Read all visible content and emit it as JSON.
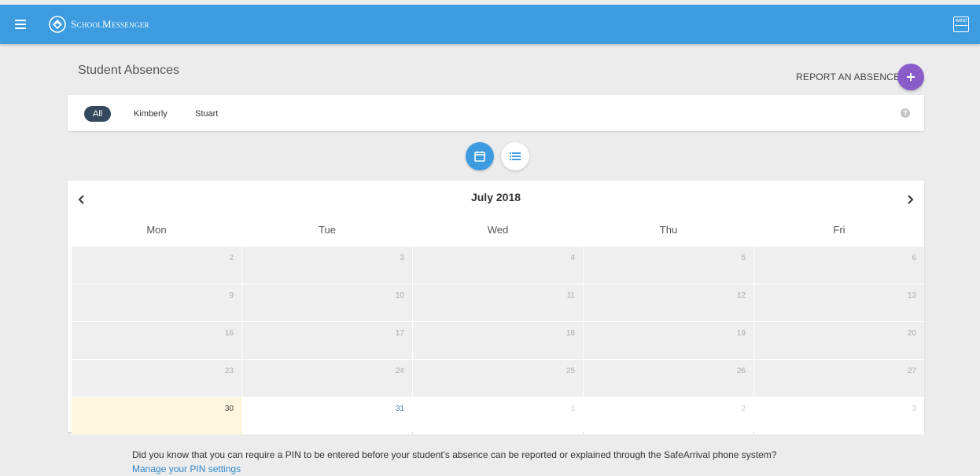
{
  "app": {
    "brand": "SchoolMessenger",
    "user_badge": "west"
  },
  "page": {
    "title": "Student Absences",
    "report_label": "REPORT AN ABSENCE"
  },
  "filters": {
    "chips": [
      "All",
      "Kimberly",
      "Stuart"
    ],
    "active": "All"
  },
  "calendar": {
    "month_label": "July 2018",
    "weekdays": [
      "Mon",
      "Tue",
      "Wed",
      "Thu",
      "Fri"
    ],
    "weeks": [
      [
        "2",
        "3",
        "4",
        "5",
        "6"
      ],
      [
        "9",
        "10",
        "11",
        "12",
        "13"
      ],
      [
        "16",
        "17",
        "18",
        "19",
        "20"
      ],
      [
        "23",
        "24",
        "25",
        "26",
        "27"
      ],
      [
        "30",
        "31",
        "1",
        "2",
        "3"
      ]
    ],
    "today": "30"
  },
  "footer": {
    "pin_notice": "Did you know that you can require a PIN to be entered before your student's absence can be reported or explained through the SafeArrival phone system?",
    "pin_link": "Manage your PIN settings"
  },
  "colors": {
    "topbar": "#3d9be0",
    "accent_purple": "#8a5cc9",
    "chip_active": "#34495e",
    "today_bg": "#fdf6dc"
  }
}
